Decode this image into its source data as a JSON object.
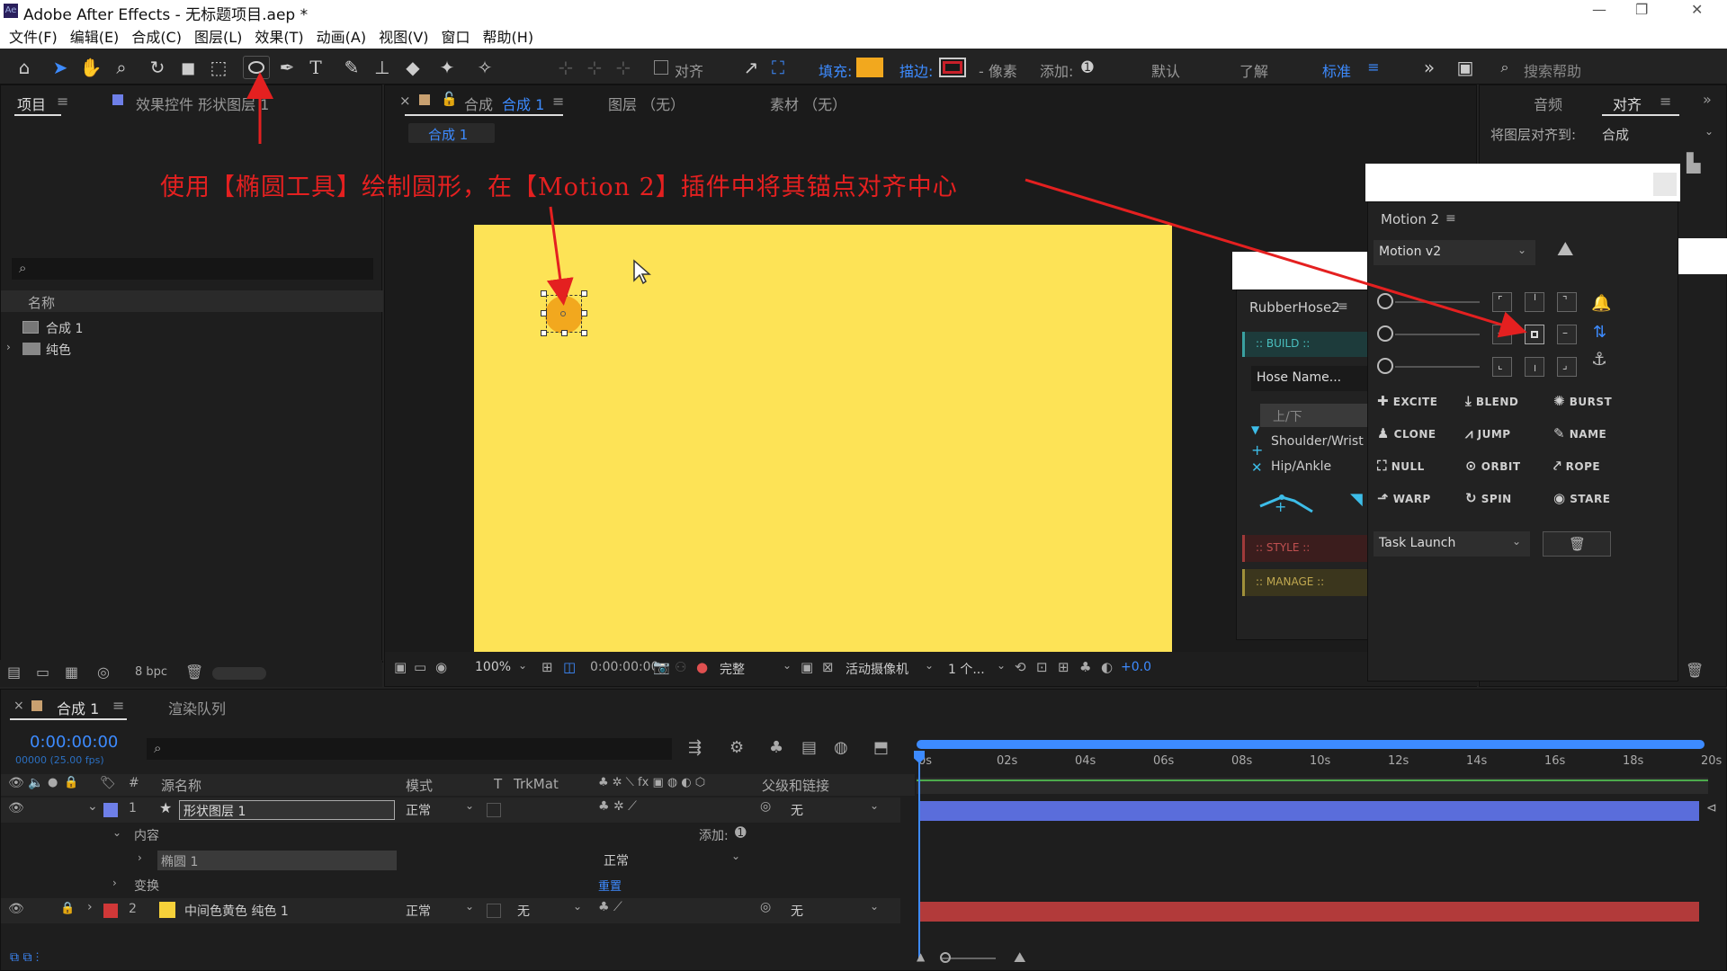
{
  "window": {
    "title": "Adobe After Effects - 无标题项目.aep *",
    "logo": "Ae",
    "min": "—",
    "max": "❐",
    "close": "✕"
  },
  "menu": [
    "文件(F)",
    "编辑(E)",
    "合成(C)",
    "图层(L)",
    "效果(T)",
    "动画(A)",
    "视图(V)",
    "窗口",
    "帮助(H)"
  ],
  "toolbar": {
    "align": "对齐",
    "fill": "填充:",
    "stroke": "描边:",
    "px": "- 像素",
    "add": "添加:",
    "ws_default": "默认",
    "ws_learn": "了解",
    "ws_standard": "标准",
    "search": "搜索帮助",
    "fill_color": "#f2a81e",
    "stroke_color": "#c8202a"
  },
  "project": {
    "tab": "项目",
    "effects_tab": "效果控件 形状图层 1",
    "col_name": "名称",
    "items": [
      "合成 1",
      "纯色"
    ],
    "bpc": "8 bpc"
  },
  "comp": {
    "tab_prefix": "合成",
    "tab_name": "合成 1",
    "layer_tab": "图层 （无）",
    "footage_tab": "素材 （无）",
    "breadcrumb": "合成 1",
    "zoom": "100%",
    "time": "0:00:00:00",
    "quality": "完整",
    "camera": "活动摄像机",
    "views": "1 个...",
    "exposure": "+0.0",
    "bg_color": "#fde356",
    "circle_color": "#f2a81e"
  },
  "annotation": "使用【椭圆工具】绘制圆形，在【Motion 2】插件中将其锚点对齐中心",
  "right": {
    "audio": "音频",
    "align": "对齐",
    "align_to_label": "将图层对齐到:",
    "align_to": "合成"
  },
  "rubberhose": {
    "title": "RubberHose2",
    "build": ":: BUILD ::",
    "hose_name": "Hose Name...",
    "updown": "上/下",
    "shoulder": "Shoulder/Wrist",
    "hip": "Hip/Ankle",
    "style": ":: STYLE ::",
    "manage": ":: MANAGE ::"
  },
  "motion": {
    "title": "Motion 2",
    "version": "Motion v2",
    "buttons": [
      "EXCITE",
      "BLEND",
      "BURST",
      "CLONE",
      "JUMP",
      "NAME",
      "NULL",
      "ORBIT",
      "ROPE",
      "WARP",
      "SPIN",
      "STARE"
    ],
    "task": "Task Launch"
  },
  "timeline": {
    "tab": "合成 1",
    "render": "渲染队列",
    "time": "0:00:00:00",
    "frames": "00000 (25.00 fps)",
    "headers": {
      "source": "源名称",
      "mode": "模式",
      "t": "T",
      "trkmat": "TrkMat",
      "parent": "父级和链接"
    },
    "ruler": [
      "0s",
      "02s",
      "04s",
      "06s",
      "08s",
      "10s",
      "12s",
      "14s",
      "16s",
      "18s",
      "20s"
    ],
    "layer1": {
      "num": "1",
      "name": "形状图层 1",
      "mode": "正常",
      "parent": "无",
      "color": "#6e7fe8"
    },
    "content": "内容",
    "add": "添加:",
    "ellipse": "椭圆 1",
    "ellipse_mode": "正常",
    "transform": "变换",
    "reset": "重置",
    "layer2": {
      "num": "2",
      "name": "中间色黄色 纯色 1",
      "mode": "正常",
      "trk": "无",
      "parent": "无",
      "color": "#d03838",
      "swatch": "#f6d13a"
    }
  }
}
